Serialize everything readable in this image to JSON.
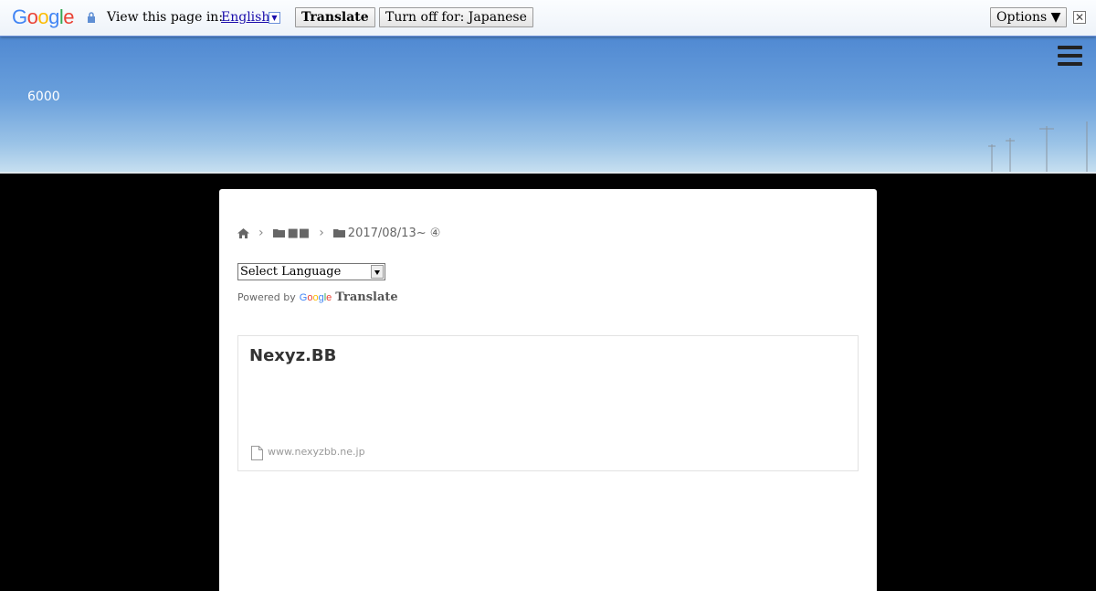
{
  "translate_bar": {
    "logo_letters": [
      {
        "ch": "G",
        "color": "#4285f4"
      },
      {
        "ch": "o",
        "color": "#ea4335"
      },
      {
        "ch": "o",
        "color": "#fbbc05"
      },
      {
        "ch": "g",
        "color": "#4285f4"
      },
      {
        "ch": "l",
        "color": "#34a853"
      },
      {
        "ch": "e",
        "color": "#ea4335"
      }
    ],
    "prompt": "View this page in:",
    "language": "English",
    "translate_button": "Translate",
    "turn_off_button": "Turn off for: Japanese",
    "options_button": "Options ▼",
    "close_symbol": "✕"
  },
  "header": {
    "site_brand": "6000",
    "menu_icon": "hamburger-menu-icon"
  },
  "breadcrumb": {
    "home_icon": "home-icon",
    "separator": "›",
    "category": "■■",
    "current": "2017/08/13~ ④"
  },
  "language_widget": {
    "select_value": "Select Language",
    "powered_by": "Powered by",
    "google": "Google",
    "translate": "Translate"
  },
  "link_card": {
    "title": "Nexyz.BB",
    "url": "www.nexyzbb.ne.jp"
  },
  "colors": {
    "link_blue": "#1a0dab",
    "sky_top": "#5089d2",
    "sky_bottom": "#c6dff0",
    "page_bg": "#000000"
  }
}
